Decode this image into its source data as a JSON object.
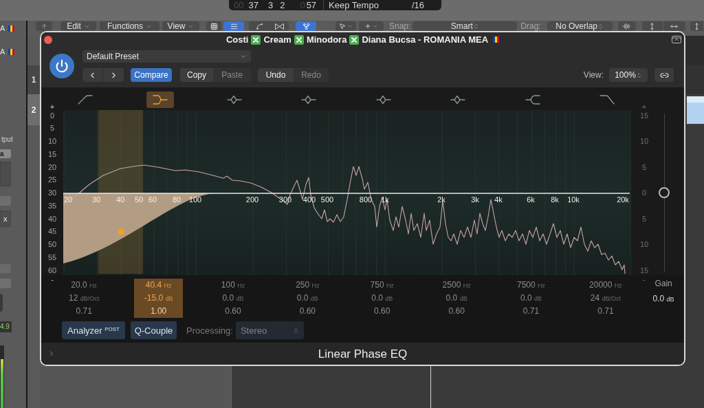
{
  "lcd": {
    "position": [
      {
        "text": "00",
        "dim": true
      },
      {
        "text": "37",
        "dim": false
      },
      {
        "text": "3",
        "dim": false
      },
      {
        "text": "2",
        "dim": false
      },
      {
        "text": "0",
        "dim": true
      },
      {
        "text": "57",
        "dim": false
      }
    ],
    "mode": "Keep Tempo",
    "division": "/16"
  },
  "inspector": {
    "track_labels": [
      "A",
      "A"
    ],
    "output_label": "tput",
    "output_value": "a",
    "button_text": "x",
    "meter_reading": "4.9",
    "meter": {
      "level": 0.78
    }
  },
  "toolbar": {
    "menus": [
      "Edit",
      "Functions",
      "View"
    ],
    "view_toggles": [
      {
        "selected": false
      },
      {
        "selected": true
      }
    ],
    "catch_button": {
      "on": true
    },
    "snap": {
      "label": "Snap:",
      "value": "Smart"
    },
    "drag": {
      "label": "Drag:",
      "value": "No Overlap"
    }
  },
  "tracks": [
    {
      "number": "1",
      "selected": false
    },
    {
      "number": "2",
      "selected": true
    }
  ],
  "plugin": {
    "title": [
      "Costi",
      "Cream",
      "Minodora",
      "Diana Bucsa - ROMANIA MEA"
    ],
    "power": {
      "on": true
    },
    "preset": "Default Preset",
    "compare": {
      "label": "Compare",
      "selected": true
    },
    "clipboard": [
      {
        "label": "Copy",
        "disabled": false
      },
      {
        "label": "Paste",
        "disabled": true
      }
    ],
    "history": [
      {
        "label": "Undo",
        "disabled": false
      },
      {
        "label": "Redo",
        "disabled": true
      }
    ],
    "view": {
      "label": "View:",
      "value": "100%"
    },
    "analyzer_scale": {
      "top": "+",
      "labels": [
        "0",
        "5",
        "10",
        "15",
        "20",
        "25",
        "30",
        "35",
        "40",
        "45",
        "50",
        "55",
        "60"
      ],
      "bottom": "-"
    },
    "gain_scale": {
      "top": "+",
      "labels": [
        "15",
        "10",
        "5",
        "0",
        "5",
        "10",
        "15"
      ],
      "bottom": "-"
    },
    "frequency_labels": [
      "20",
      "30",
      "40",
      "50",
      "60",
      "80",
      "100",
      "200",
      "300",
      "400",
      "500",
      "800",
      "1k",
      "2k",
      "3k",
      "4k",
      "6k",
      "8k",
      "10k",
      "20k"
    ],
    "bands": [
      {
        "kind": "low_cut",
        "selected": false,
        "frequency": {
          "value": "20.0",
          "unit": "Hz"
        },
        "slope": {
          "value": "12",
          "unit": "dB/Oct"
        },
        "q": "0.71"
      },
      {
        "kind": "low_shelf",
        "selected": true,
        "frequency": {
          "value": "40.4",
          "unit": "Hz"
        },
        "gain": {
          "value": "-15.0",
          "unit": "dB"
        },
        "q": "1.00"
      },
      {
        "kind": "bell",
        "selected": false,
        "frequency": {
          "value": "100",
          "unit": "Hz"
        },
        "gain": {
          "value": "0.0",
          "unit": "dB"
        },
        "q": "0.60"
      },
      {
        "kind": "bell",
        "selected": false,
        "frequency": {
          "value": "250",
          "unit": "Hz"
        },
        "gain": {
          "value": "0.0",
          "unit": "dB"
        },
        "q": "0.60"
      },
      {
        "kind": "bell",
        "selected": false,
        "frequency": {
          "value": "750",
          "unit": "Hz"
        },
        "gain": {
          "value": "0.0",
          "unit": "dB"
        },
        "q": "0.60"
      },
      {
        "kind": "bell",
        "selected": false,
        "frequency": {
          "value": "2500",
          "unit": "Hz"
        },
        "gain": {
          "value": "0.0",
          "unit": "dB"
        },
        "q": "0.60"
      },
      {
        "kind": "high_shelf",
        "selected": false,
        "frequency": {
          "value": "7500",
          "unit": "Hz"
        },
        "gain": {
          "value": "0.0",
          "unit": "dB"
        },
        "q": "0.71"
      },
      {
        "kind": "high_cut",
        "selected": false,
        "frequency": {
          "value": "20000",
          "unit": "Hz"
        },
        "slope": {
          "value": "24",
          "unit": "dB/Oct"
        },
        "q": "0.71"
      }
    ],
    "gain": {
      "label": "Gain",
      "value": "0.0",
      "unit": "dB",
      "level": 0.5
    },
    "analyzer": {
      "label": "Analyzer $^{POST}$",
      "on": true
    },
    "q_couple": {
      "label": "Q-Couple",
      "on": true
    },
    "processing": {
      "label": "Processing:",
      "value": "Stereo",
      "disabled": true
    },
    "name": "Linear Phase EQ"
  }
}
